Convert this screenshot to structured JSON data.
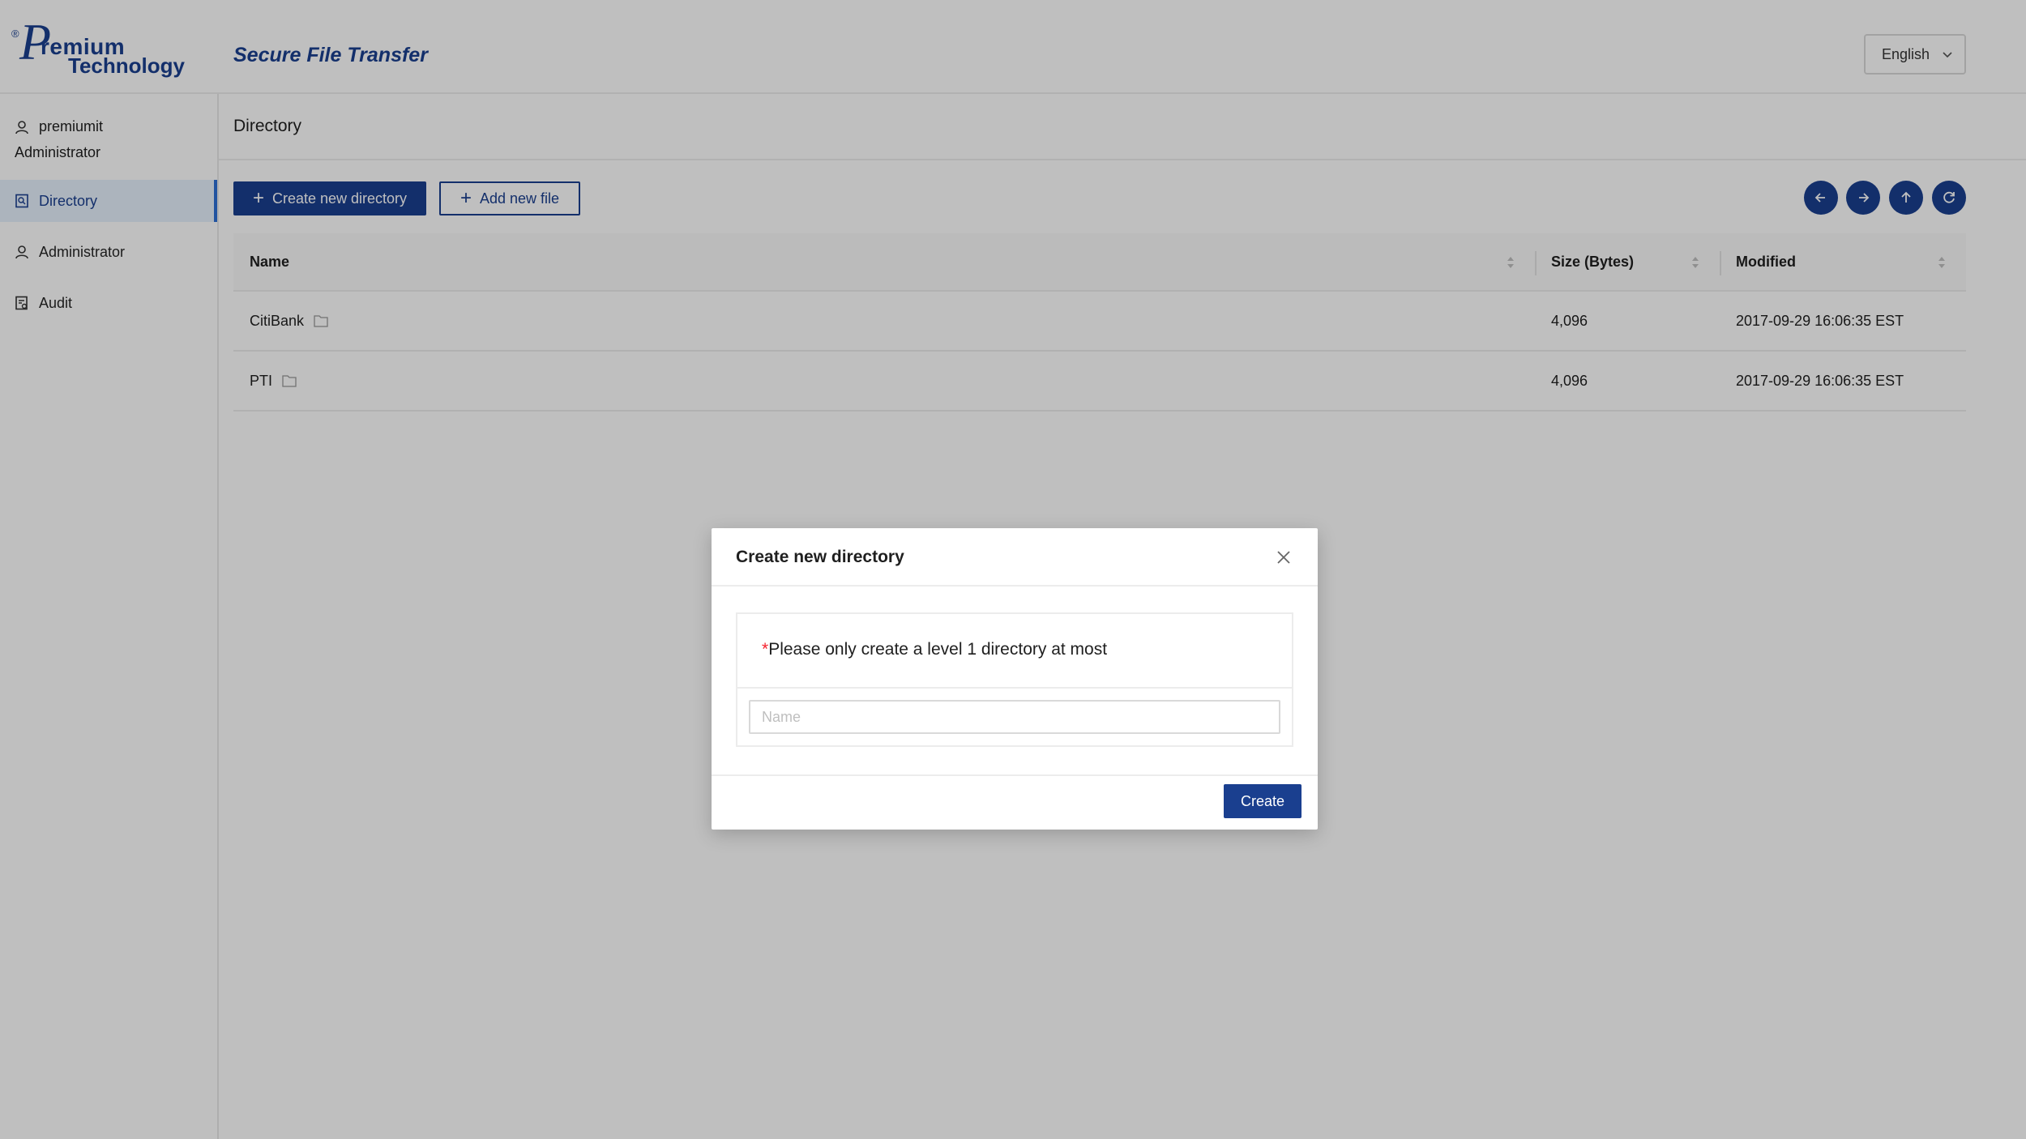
{
  "header": {
    "logo_reg": "®",
    "logo_line1": "remium",
    "logo_line2": "Technology",
    "app_title": "Secure File Transfer",
    "language": "English"
  },
  "sidebar": {
    "username": "premiumit",
    "role": "Administrator",
    "items": [
      {
        "label": "Directory",
        "icon": "directory-icon",
        "active": true
      },
      {
        "label": "Administrator",
        "icon": "user-icon",
        "active": false
      },
      {
        "label": "Audit",
        "icon": "audit-icon",
        "active": false
      }
    ]
  },
  "main": {
    "page_title": "Directory",
    "toolbar": {
      "create_dir_label": "Create new directory",
      "add_file_label": "Add new file",
      "nav_buttons": [
        "back-icon",
        "forward-icon",
        "up-icon",
        "refresh-icon"
      ]
    },
    "table": {
      "columns": [
        "Name",
        "Size (Bytes)",
        "Modified"
      ],
      "rows": [
        {
          "name": "CitiBank",
          "size": "4,096",
          "modified": "2017-09-29 16:06:35 EST"
        },
        {
          "name": "PTI",
          "size": "4,096",
          "modified": "2017-09-29 16:06:35 EST"
        }
      ]
    }
  },
  "modal": {
    "title": "Create new directory",
    "required_mark": "*",
    "note": "Please only create a level 1 directory at most",
    "input_placeholder": "Name",
    "input_value": "",
    "create_label": "Create"
  },
  "colors": {
    "brand": "#1a3f8f",
    "active_nav_bg": "#e6f0fc",
    "active_nav_bar": "#2c6fd6",
    "required": "#f5222d",
    "overlay": "rgba(0,0,0,0.25)"
  }
}
